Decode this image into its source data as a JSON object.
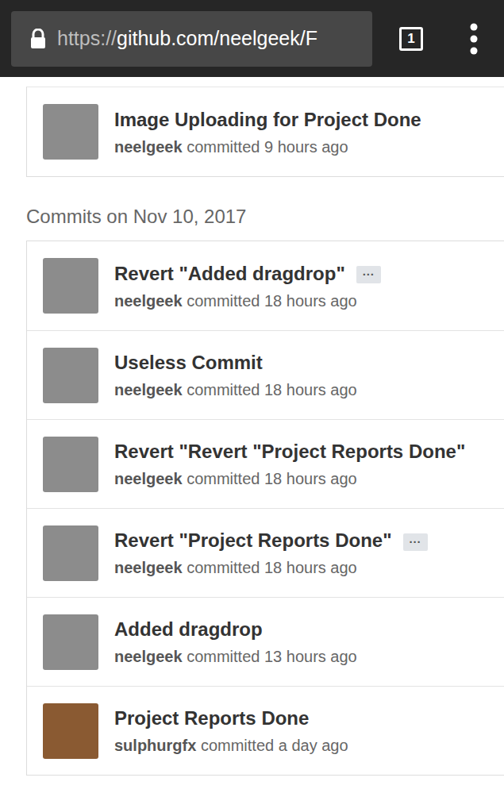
{
  "browser": {
    "scheme": "https://",
    "address": "github.com/neelgeek/F",
    "tab_count": "1"
  },
  "groups": [
    {
      "commits": [
        {
          "title": "Image Uploading for Project Done",
          "badge": "",
          "author": "neelgeek",
          "action": "committed",
          "time": "9 hours ago",
          "color": "#8c8c8c"
        }
      ]
    },
    {
      "heading": "Commits on Nov 10, 2017",
      "commits": [
        {
          "title": "Revert \"Added dragdrop\"",
          "badge": "···",
          "author": "neelgeek",
          "action": "committed",
          "time": "18 hours ago",
          "color": "#8c8c8c"
        },
        {
          "title": "Useless Commit",
          "badge": "",
          "author": "neelgeek",
          "action": "committed",
          "time": "18 hours ago",
          "color": "#8c8c8c"
        },
        {
          "title": "Revert \"Revert \"Project Reports Done\"",
          "badge": "",
          "author": "neelgeek",
          "action": "committed",
          "time": "18 hours ago",
          "color": "#8c8c8c"
        },
        {
          "title": "Revert \"Project Reports Done\"",
          "badge": "···",
          "author": "neelgeek",
          "action": "committed",
          "time": "18 hours ago",
          "color": "#8c8c8c"
        },
        {
          "title": "Added dragdrop",
          "badge": "",
          "author": "neelgeek",
          "action": "committed",
          "time": "13 hours ago",
          "color": "#8c8c8c"
        },
        {
          "title": "Project Reports Done",
          "badge": "",
          "author": "sulphurgfx",
          "action": "committed",
          "time": "a day ago",
          "color": "#8a5a32"
        }
      ]
    }
  ]
}
